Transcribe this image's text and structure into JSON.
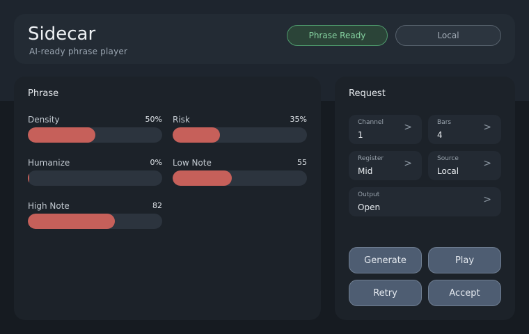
{
  "header": {
    "title": "Sidecar",
    "subtitle": "AI-ready phrase player",
    "status_pill": "Phrase Ready",
    "mode_pill": "Local"
  },
  "colors": {
    "accent_fill": "#c6605a",
    "status_green": "#86d3a1",
    "button_bg": "#4e5d72"
  },
  "phrase": {
    "title": "Phrase",
    "sliders": [
      {
        "label": "Density",
        "value_text": "50%",
        "fraction": 0.5
      },
      {
        "label": "Risk",
        "value_text": "35%",
        "fraction": 0.35
      },
      {
        "label": "Humanize",
        "value_text": "0%",
        "fraction": 0.0
      },
      {
        "label": "Low Note",
        "value_text": "55",
        "fraction": 0.44
      },
      {
        "label": "High Note",
        "value_text": "82",
        "fraction": 0.65
      }
    ]
  },
  "request": {
    "title": "Request",
    "fields": [
      {
        "label": "Channel",
        "value": "1",
        "chevron": ">"
      },
      {
        "label": "Bars",
        "value": "4",
        "chevron": ">"
      },
      {
        "label": "Register",
        "value": "Mid",
        "chevron": ">"
      },
      {
        "label": "Source",
        "value": "Local",
        "chevron": ">"
      },
      {
        "label": "Output",
        "value": "Open",
        "chevron": ">"
      }
    ],
    "buttons": {
      "generate": "Generate",
      "play": "Play",
      "retry": "Retry",
      "accept": "Accept"
    }
  }
}
